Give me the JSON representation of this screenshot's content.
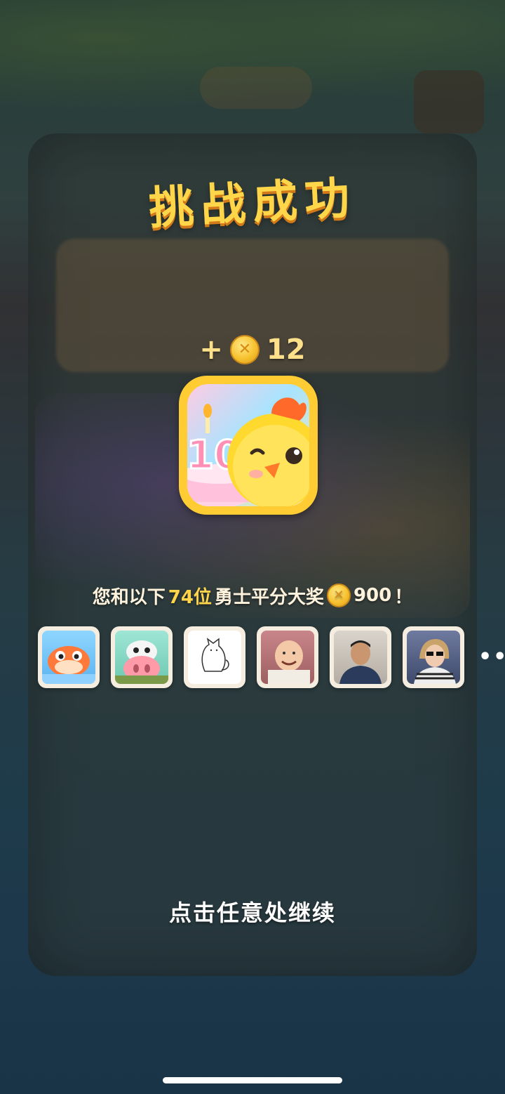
{
  "title": "挑战成功",
  "reward": {
    "prefix": "+",
    "coin_icon": "coin-icon",
    "amount": "12"
  },
  "app_icon": {
    "badge_number": "10"
  },
  "share": {
    "part1": "您和以下",
    "count": "74位",
    "part2": "勇士平分大奖",
    "prize": "900",
    "suffix": "！"
  },
  "avatars": [
    "puffer-fish-avatar",
    "cow-avatar",
    "cat-sketch-avatar",
    "baby-photo-avatar",
    "man-photo-avatar",
    "woman-photo-avatar"
  ],
  "more_label": "•••",
  "continue_label": "点击任意处继续",
  "colors": {
    "title": "#ffd54a",
    "highlight": "#ffd54a",
    "coin": "#f7c22f",
    "frame": "#ffcc33"
  }
}
